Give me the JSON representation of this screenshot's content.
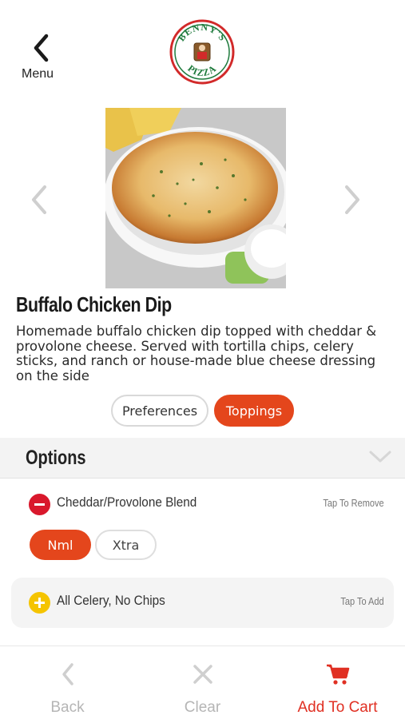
{
  "header": {
    "back_label": "Menu",
    "logo_text_top": "BENNY'S",
    "logo_text_bottom": "PIZZA"
  },
  "item": {
    "title": "Buffalo Chicken Dip",
    "description": "Homemade buffalo chicken dip topped with cheddar & provolone cheese. Served with tortilla chips, celery sticks, and ranch or house-made blue cheese dressing on the side"
  },
  "tabs": [
    {
      "label": "Preferences",
      "active": false
    },
    {
      "label": "Toppings",
      "active": true
    }
  ],
  "options": {
    "title": "Options",
    "rows": [
      {
        "name": "Cheddar/Provolone Blend",
        "hint": "Tap To Remove",
        "state": "selected",
        "icon": "minus-icon"
      },
      {
        "name": "All Celery, No Chips",
        "hint": "Tap To Add",
        "state": "unselected",
        "icon": "plus-icon"
      }
    ],
    "sizes": [
      {
        "label": "Nml",
        "selected": true
      },
      {
        "label": "Xtra",
        "selected": false
      }
    ]
  },
  "toolbar": {
    "back_label": "Back",
    "clear_label": "Clear",
    "cart_label": "Add To Cart"
  },
  "colors": {
    "accent": "#e4461c",
    "remove": "#d9182c",
    "add": "#f5c400",
    "cart": "#e03023",
    "muted": "#b5b5b5"
  }
}
